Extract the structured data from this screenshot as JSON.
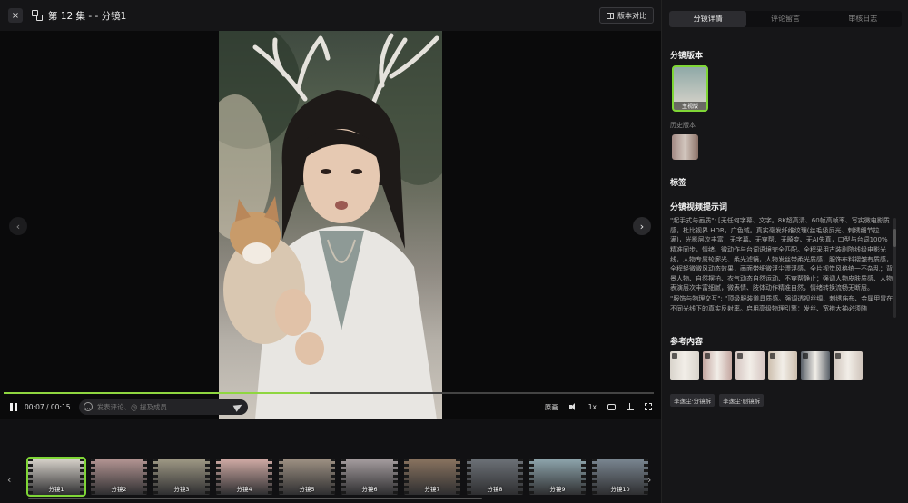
{
  "header": {
    "close_icon": "×",
    "title": "第 12 集 - - 分镜1",
    "compare_label": "版本对比"
  },
  "player": {
    "time": "00:07 / 00:15",
    "progress": 0.47,
    "comment_placeholder": "发表评论、@ 提及成员...",
    "quality_label": "原画",
    "speed_label": "1x",
    "accent": "#8fd640"
  },
  "filmstrip": {
    "shots": [
      {
        "label": "分镜1",
        "active": true,
        "color": "#d9d4cc"
      },
      {
        "label": "分镜2",
        "active": false,
        "color": "#b59694"
      },
      {
        "label": "分镜3",
        "active": false,
        "color": "#a09a86"
      },
      {
        "label": "分镜4",
        "active": false,
        "color": "#d2aca6"
      },
      {
        "label": "分镜5",
        "active": false,
        "color": "#9f9284"
      },
      {
        "label": "分镜6",
        "active": false,
        "color": "#a69ea0"
      },
      {
        "label": "分镜7",
        "active": false,
        "color": "#8a7460"
      },
      {
        "label": "分镜8",
        "active": false,
        "color": "#6d7278"
      },
      {
        "label": "分镜9",
        "active": false,
        "color": "#8fa6ae"
      },
      {
        "label": "分镜10",
        "active": false,
        "color": "#7b8792"
      }
    ]
  },
  "panel": {
    "tabs": [
      {
        "label": "分镜详情",
        "active": true
      },
      {
        "label": "评论留言",
        "active": false
      },
      {
        "label": "审核日志",
        "active": false
      }
    ],
    "version_title": "分镜版本",
    "main_version_tag": "主视版",
    "history_label": "历史版本",
    "tags_title": "标签",
    "prompt_title": "分镜视频提示词",
    "prompt_paragraphs": [
      "\"起手式与画质\": [无任何字幕、文字。8K超高清、60帧高帧率、写实微电影质感，杜比视界 HDR，广色域。真实毫发纤维纹理(丝毛级反光、刺绣细节拉满)，光影层次丰富，无字幕、无穿帮、无畸变、无AI失真，口型与台词100%精准同步，情绪、微动作与台词语境完全匹配。全程采用古装剧院线级电影光线，人物专属轮廓光、柔光滤镜，人物发丝带柔光质感，服饰布料褶皱有质感，全程轻微微风动态效果，画面带细微浮尘漂浮感，全片视觉风格统一不杂乱；背景人物、自然摆拍、衣气动态自然运动、不穿帮静止；强调人物皮肤质感、人物表演层次丰富细腻，微表情、肢体动作精准自然，情绪转换流畅无断层。",
      "\"服饰与物理交互\": \"顶级服装道具质感。强调透视丝绸、刺绣庙布、金属甲胄在不同光线下的真实反射率。启用高级物理引擎：发丝、宽袍大袖必须随"
    ],
    "refs_title": "参考内容",
    "refs": [
      {
        "color": "#d9d4cc"
      },
      {
        "color": "#c4a6a0"
      },
      {
        "color": "#d6c6c2"
      },
      {
        "color": "#cdbfae"
      },
      {
        "color": "#596068"
      },
      {
        "color": "#cfc4bb"
      }
    ],
    "ref_tags": [
      "李逸尘·分镜拆",
      "李逸尘·剧镜拆"
    ]
  }
}
